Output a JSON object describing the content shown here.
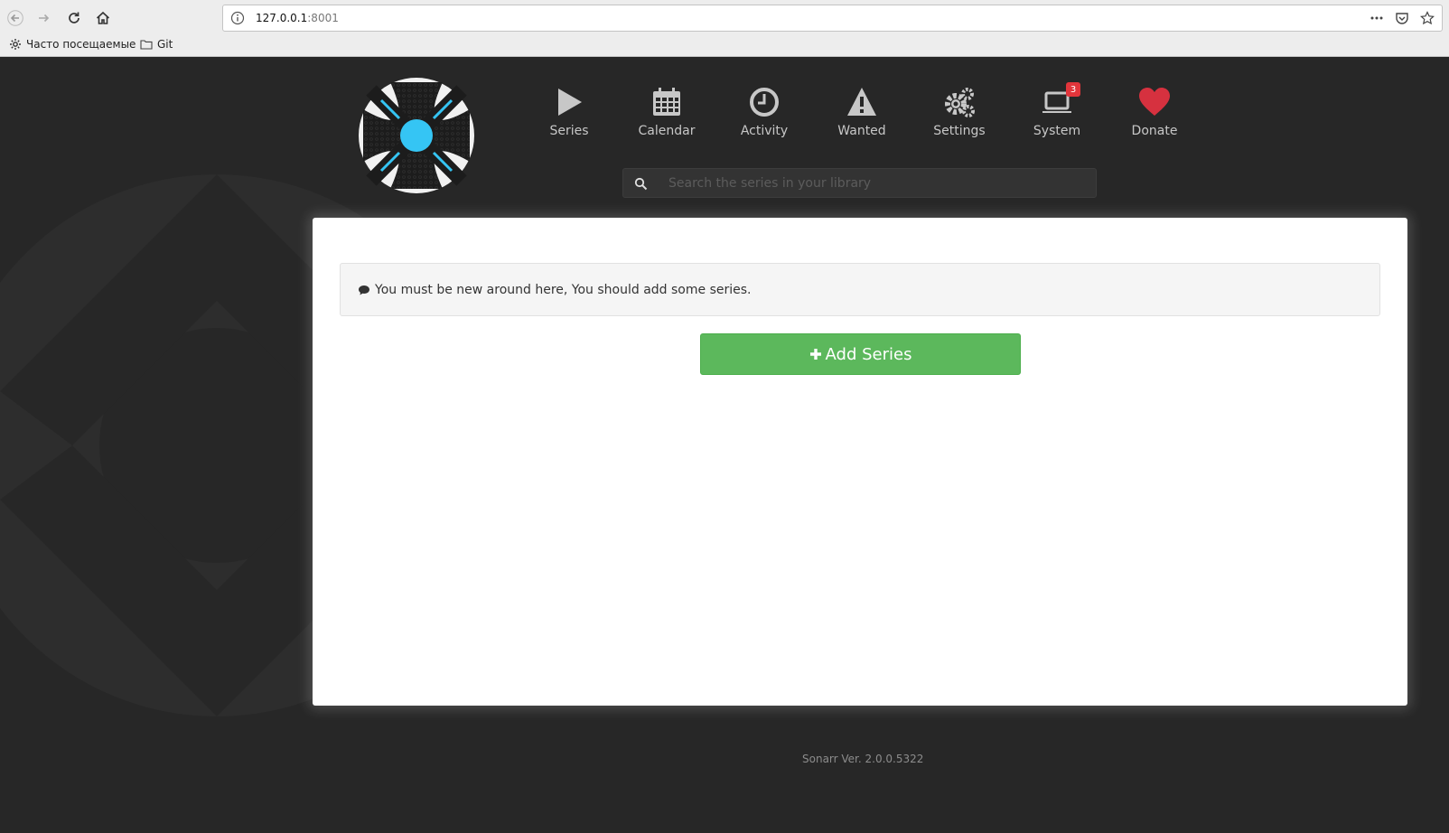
{
  "browser": {
    "url_host": "127.0.0.1",
    "url_port": ":8001",
    "bookmarks": [
      {
        "label": "Часто посещаемые",
        "icon": "gear-icon"
      },
      {
        "label": "Git",
        "icon": "folder-icon"
      }
    ]
  },
  "nav": {
    "items": [
      {
        "label": "Series",
        "icon": "play-icon"
      },
      {
        "label": "Calendar",
        "icon": "calendar-icon"
      },
      {
        "label": "Activity",
        "icon": "clock-icon"
      },
      {
        "label": "Wanted",
        "icon": "warning-icon"
      },
      {
        "label": "Settings",
        "icon": "gears-icon"
      },
      {
        "label": "System",
        "icon": "laptop-icon",
        "badge": "3"
      },
      {
        "label": "Donate",
        "icon": "heart-icon"
      }
    ]
  },
  "search": {
    "placeholder": "Search the series in your library"
  },
  "main": {
    "alert_text": "You must be new around here, You should add some series.",
    "add_series_label": "Add Series"
  },
  "footer": {
    "version": "Sonarr Ver. 2.0.0.5322"
  },
  "colors": {
    "background": "#272727",
    "accent_blue": "#35c5f4",
    "success_green": "#5cb85c",
    "badge_red": "#e2353b",
    "heart_red": "#d6313f"
  }
}
